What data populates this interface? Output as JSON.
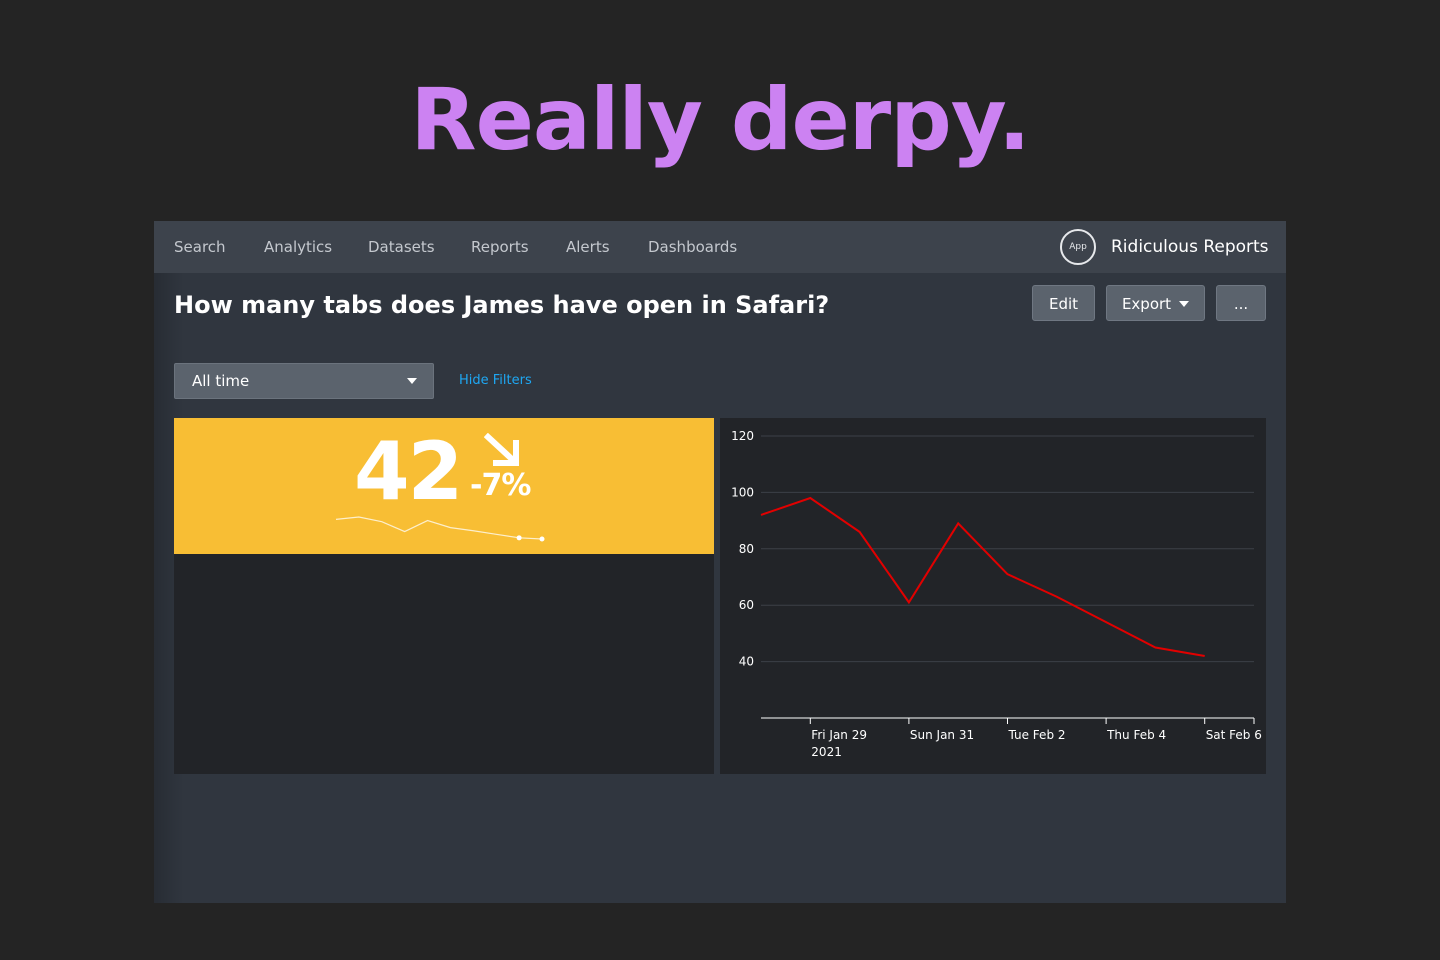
{
  "slide": {
    "title": "Really derpy."
  },
  "nav": {
    "items": [
      {
        "label": "Search"
      },
      {
        "label": "Analytics"
      },
      {
        "label": "Datasets"
      },
      {
        "label": "Reports"
      },
      {
        "label": "Alerts"
      },
      {
        "label": "Dashboards"
      }
    ],
    "app_badge": "App",
    "app_name": "Ridiculous Reports"
  },
  "report": {
    "title": "How many tabs does James have open in Safari?",
    "edit_label": "Edit",
    "export_label": "Export",
    "more_label": "..."
  },
  "filters": {
    "time_range": "All time",
    "hide_filters_label": "Hide Filters"
  },
  "kpi": {
    "value": "42",
    "delta": "-7%",
    "trend_icon": "arrow-down-right-icon",
    "color": "#f8be34"
  },
  "chart_data": {
    "type": "line",
    "x": [
      "2021-01-28",
      "2021-01-29",
      "2021-01-30",
      "2021-01-31",
      "2021-02-01",
      "2021-02-02",
      "2021-02-03",
      "2021-02-04",
      "2021-02-05",
      "2021-02-06"
    ],
    "series": [
      {
        "values": [
          92,
          98,
          86,
          61,
          89,
          71,
          63,
          54,
          45,
          42
        ],
        "color": "#e20000"
      }
    ],
    "y_ticks": [
      40,
      60,
      80,
      100,
      120
    ],
    "x_ticks": [
      {
        "x": "2021-01-29",
        "label": "Fri Jan 29",
        "sublabel": "2021"
      },
      {
        "x": "2021-01-31",
        "label": "Sun Jan 31"
      },
      {
        "x": "2021-02-02",
        "label": "Tue Feb 2"
      },
      {
        "x": "2021-02-04",
        "label": "Thu Feb 4"
      },
      {
        "x": "2021-02-06",
        "label": "Sat Feb 6"
      }
    ],
    "ylim": [
      20,
      120
    ],
    "xlim": [
      "2021-01-28",
      "2021-02-07"
    ],
    "grid": true
  }
}
